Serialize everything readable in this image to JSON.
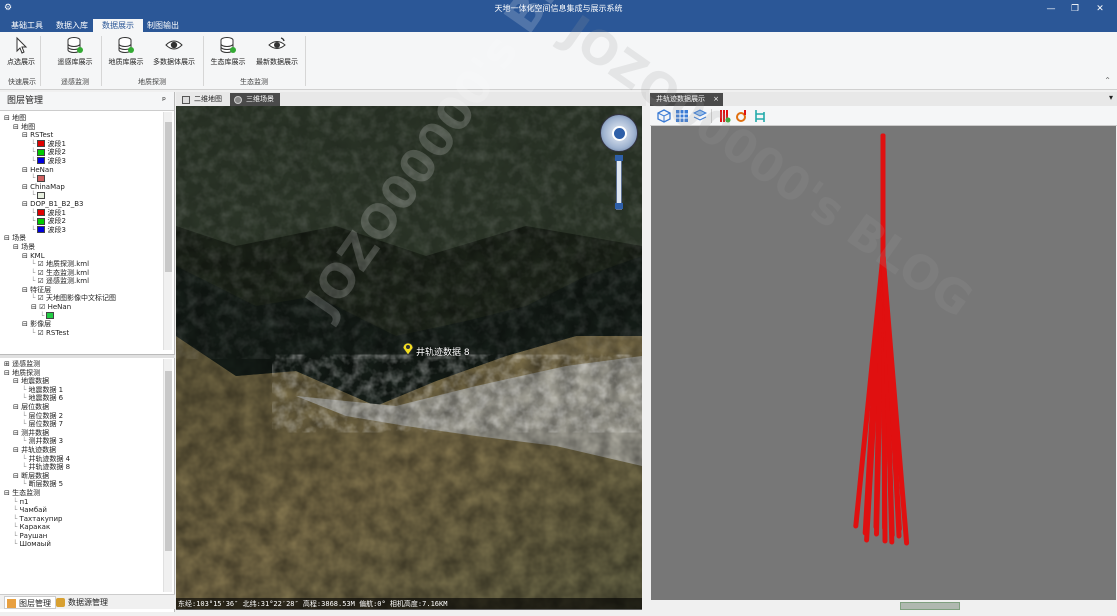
{
  "window": {
    "title": "天地一体化空间信息集成与展示系统",
    "minimize": "—",
    "restore": "❐",
    "close": "✕"
  },
  "menu": {
    "tabs": [
      "基础工具",
      "数据入库",
      "数据展示",
      "制图输出"
    ],
    "active_index": 2
  },
  "ribbon": {
    "buttons": [
      {
        "label": "点选展示",
        "icon": "pointer-icon"
      },
      {
        "label": "遥感库展示",
        "icon": "database-icon"
      },
      {
        "label": "地质库展示",
        "icon": "database-icon"
      },
      {
        "label": "多数据体展示",
        "icon": "eye-icon"
      },
      {
        "label": "生态库展示",
        "icon": "database-icon"
      },
      {
        "label": "最新数据展示",
        "icon": "eye-refresh-icon"
      }
    ],
    "groups": [
      "快速展示",
      "遥感监测",
      "地质探测",
      "生态监测"
    ]
  },
  "layer_panel": {
    "title": "图层管理",
    "pin": "ᵖ",
    "tree": [
      {
        "d": 0,
        "exp": "⊟",
        "text": "地图"
      },
      {
        "d": 1,
        "exp": "⊟",
        "text": "地图"
      },
      {
        "d": 2,
        "exp": "⊟",
        "text": "RSTest"
      },
      {
        "d": 3,
        "sw": "#e00000",
        "text": "波段1"
      },
      {
        "d": 3,
        "sw": "#00cc00",
        "text": "波段2"
      },
      {
        "d": 3,
        "sw": "#0000dd",
        "text": "波段3"
      },
      {
        "d": 2,
        "exp": "⊟",
        "text": "HeNan"
      },
      {
        "d": 3,
        "sw": "#d06060",
        "text": ""
      },
      {
        "d": 2,
        "exp": "⊟",
        "text": "ChinaMap"
      },
      {
        "d": 3,
        "sw": "#e8f0e0",
        "text": ""
      },
      {
        "d": 2,
        "exp": "⊟",
        "text": "DOP_B1_B2_B3"
      },
      {
        "d": 3,
        "sw": "#e00000",
        "text": "波段1"
      },
      {
        "d": 3,
        "sw": "#00cc00",
        "text": "波段2"
      },
      {
        "d": 3,
        "sw": "#0000dd",
        "text": "波段3"
      },
      {
        "d": 0,
        "exp": "⊟",
        "text": "场景"
      },
      {
        "d": 1,
        "exp": "⊟",
        "text": "场景"
      },
      {
        "d": 2,
        "exp": "⊟",
        "text": "KML"
      },
      {
        "d": 3,
        "chk": true,
        "text": "地质探测.kml"
      },
      {
        "d": 3,
        "chk": true,
        "text": "生态监测.kml"
      },
      {
        "d": 3,
        "chk": true,
        "text": "遥感监测.kml"
      },
      {
        "d": 2,
        "exp": "⊟",
        "text": "特征层"
      },
      {
        "d": 3,
        "chk": true,
        "text": "天地图影像中文标记图"
      },
      {
        "d": 3,
        "chk": true,
        "exp": "⊟",
        "text": "HeNan"
      },
      {
        "d": 4,
        "sw": "#22cc44",
        "text": ""
      },
      {
        "d": 2,
        "exp": "⊟",
        "text": "影像层"
      },
      {
        "d": 3,
        "chk": true,
        "text": "RSTest"
      }
    ]
  },
  "data_tree": [
    {
      "d": 0,
      "exp": "⊞",
      "text": "遥感监测"
    },
    {
      "d": 0,
      "exp": "⊟",
      "text": "地质探测"
    },
    {
      "d": 1,
      "exp": "⊟",
      "text": "地震数据"
    },
    {
      "d": 2,
      "text": "地震数据 1"
    },
    {
      "d": 2,
      "text": "地震数据 6"
    },
    {
      "d": 1,
      "exp": "⊟",
      "text": "层位数据"
    },
    {
      "d": 2,
      "text": "层位数据 2"
    },
    {
      "d": 2,
      "text": "层位数据 7"
    },
    {
      "d": 1,
      "exp": "⊟",
      "text": "测井数据"
    },
    {
      "d": 2,
      "text": "测井数据 3"
    },
    {
      "d": 1,
      "exp": "⊟",
      "text": "井轨迹数据"
    },
    {
      "d": 2,
      "text": "井轨迹数据 4"
    },
    {
      "d": 2,
      "text": "井轨迹数据 8"
    },
    {
      "d": 1,
      "exp": "⊟",
      "text": "断层数据"
    },
    {
      "d": 2,
      "text": "断层数据 5"
    },
    {
      "d": 0,
      "exp": "⊟",
      "text": "生态监测"
    },
    {
      "d": 1,
      "text": "п1"
    },
    {
      "d": 1,
      "text": "Чамбай"
    },
    {
      "d": 1,
      "text": "Тахтакупир"
    },
    {
      "d": 1,
      "text": "Каракак"
    },
    {
      "d": 1,
      "text": "Раушан"
    },
    {
      "d": 1,
      "text": "Шомаый"
    }
  ],
  "bottom_tabs": [
    "图层管理",
    "数据源管理"
  ],
  "center_tabs": [
    "二维地图",
    "三维场景"
  ],
  "center_active": 1,
  "map": {
    "marker_label": "井轨迹数据 8",
    "status": "东经:103°15′36″ 北纬:31°22′28″ 高程:3868.53M 偏航:0° 相机高度:7.16KM"
  },
  "right_panel": {
    "tab": "井轨迹数据展示",
    "tab_close": "×",
    "dropdown": "▾",
    "toolbar_icons": [
      "cube-view-icon",
      "grid-view-icon",
      "layers-view-icon",
      "wells-icon",
      "settings-wells-icon",
      "tree-wells-icon"
    ],
    "wells_color": "#e01010"
  },
  "watermark": "JOZO00000's BLOG"
}
